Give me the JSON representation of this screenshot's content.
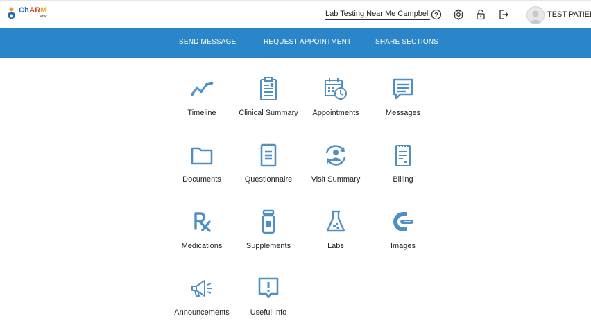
{
  "app": {
    "logo_name_part1": "Ch",
    "logo_name_part2": "AR",
    "logo_name_part3": "M",
    "logo_sub": "PHR"
  },
  "header": {
    "search_link": "Lab Testing Near Me Campbell",
    "user_name": "TEST PATIENT",
    "icons": [
      "help-icon",
      "settings-icon",
      "lock-icon",
      "logout-icon",
      "avatar"
    ]
  },
  "nav": {
    "items": [
      "SEND MESSAGE",
      "REQUEST APPOINTMENT",
      "SHARE SECTIONS"
    ]
  },
  "tiles": [
    {
      "label": "Timeline",
      "icon": "timeline-icon"
    },
    {
      "label": "Clinical Summary",
      "icon": "clipboard-icon"
    },
    {
      "label": "Appointments",
      "icon": "calendar-clock-icon"
    },
    {
      "label": "Messages",
      "icon": "message-icon"
    },
    {
      "label": "Documents",
      "icon": "folder-icon"
    },
    {
      "label": "Questionnaire",
      "icon": "questionnaire-icon"
    },
    {
      "label": "Visit Summary",
      "icon": "visit-summary-icon"
    },
    {
      "label": "Billing",
      "icon": "billing-icon"
    },
    {
      "label": "Medications",
      "icon": "rx-icon"
    },
    {
      "label": "Supplements",
      "icon": "bottle-icon"
    },
    {
      "label": "Labs",
      "icon": "flask-icon"
    },
    {
      "label": "Images",
      "icon": "scan-icon"
    },
    {
      "label": "Announcements",
      "icon": "megaphone-icon"
    },
    {
      "label": "Useful Info",
      "icon": "info-icon"
    }
  ],
  "colors": {
    "accent": "#2a86c8",
    "icon": "#4f8fc4"
  }
}
